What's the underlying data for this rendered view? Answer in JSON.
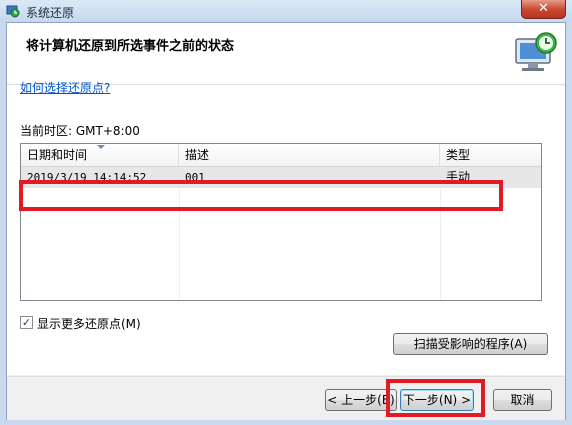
{
  "window": {
    "title": "系统还原",
    "close_symbol": "✕"
  },
  "header": {
    "title": "将计算机还原到所选事件之前的状态"
  },
  "help_link": "如何选择还原点?",
  "timezone": "当前时区: GMT+8:00",
  "list": {
    "columns": [
      "日期和时间",
      "描述",
      "类型"
    ],
    "rows": [
      {
        "datetime": "2019/3/19 14:14:52",
        "description": "001",
        "type": "手动"
      }
    ]
  },
  "show_more": {
    "label": "显示更多还原点(M)",
    "checked": true,
    "check_glyph": "✓"
  },
  "buttons": {
    "scan": "扫描受影响的程序(A)",
    "back": "< 上一步(B)",
    "next": "下一步(N) >",
    "cancel": "取消"
  },
  "colors": {
    "highlight_box": "#e21a23",
    "link": "#0055cc"
  }
}
